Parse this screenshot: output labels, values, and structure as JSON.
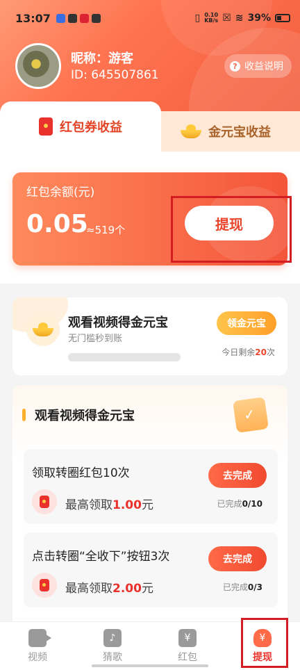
{
  "status_bar": {
    "time": "13:07",
    "net_speed_value": "0.10",
    "net_speed_unit": "KB/s",
    "battery": "39%"
  },
  "profile": {
    "nickname": "昵称：游客",
    "id": "ID: 645507861",
    "help_label": "收益说明"
  },
  "tabs": [
    {
      "label": "红包券收益",
      "active": true
    },
    {
      "label": "金元宝收益",
      "active": false
    }
  ],
  "balance": {
    "label": "红包余额(元)",
    "amount": "0.05",
    "approx": "≈519个",
    "withdraw_label": "提现"
  },
  "video_card": {
    "title": "观看视频得金元宝",
    "subtitle": "无门槛秒到账",
    "claim_label": "领金元宝",
    "remain_prefix": "今日剩余",
    "remain_count": "20",
    "remain_suffix": "次",
    "progress": 0
  },
  "task_section": {
    "title": "观看视频得金元宝",
    "tasks": [
      {
        "title": "领取转圈红包10次",
        "reward_prefix": "最高领取",
        "reward_amount": "1.00",
        "reward_unit": "元",
        "button": "去完成",
        "done_prefix": "已完成",
        "done_value": "0/10"
      },
      {
        "title": "点击转圈“全收下”按钮3次",
        "reward_prefix": "最高领取",
        "reward_amount": "2.00",
        "reward_unit": "元",
        "button": "去完成",
        "done_prefix": "已完成",
        "done_value": "0/3"
      }
    ]
  },
  "bottom_nav": [
    {
      "label": "视频",
      "icon": "video-icon",
      "active": false
    },
    {
      "label": "猜歌",
      "icon": "music-icon",
      "active": false
    },
    {
      "label": "红包",
      "icon": "yuan-wallet-icon",
      "active": false
    },
    {
      "label": "提现",
      "icon": "money-bag-icon",
      "active": true
    }
  ],
  "colors": {
    "accent": "#f05a3c",
    "annotation": "#d41c23",
    "gold": "#ffb02e"
  }
}
